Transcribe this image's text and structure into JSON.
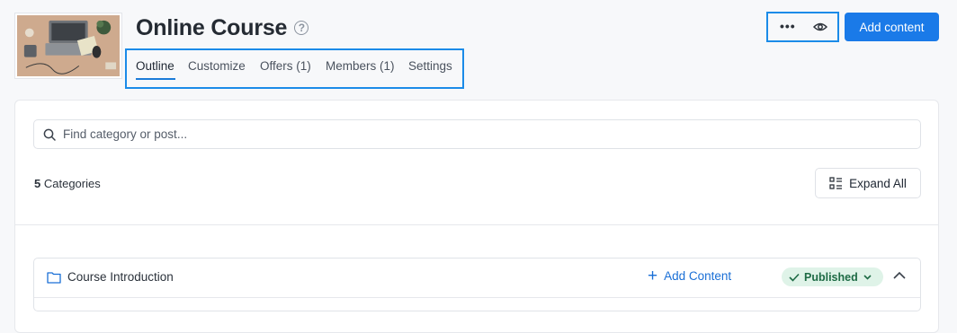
{
  "course": {
    "title": "Online Course",
    "help_icon": "?"
  },
  "tabs": [
    {
      "label": "Outline",
      "active": true
    },
    {
      "label": "Customize",
      "active": false
    },
    {
      "label": "Offers (1)",
      "active": false
    },
    {
      "label": "Members (1)",
      "active": false
    },
    {
      "label": "Settings",
      "active": false
    }
  ],
  "actions": {
    "more_icon": "•••",
    "preview_icon": "eye-icon",
    "add_content_label": "Add content"
  },
  "search": {
    "placeholder": "Find category or post..."
  },
  "summary": {
    "count": "5",
    "label": "Categories"
  },
  "expand_all_label": "Expand All",
  "categories": [
    {
      "name": "Course Introduction",
      "add_label": "Add Content",
      "status": "Published"
    }
  ],
  "colors": {
    "accent": "#1a7ae8",
    "highlight_border": "#1b8be8",
    "published_bg": "#dff3e8",
    "published_text": "#1e6b45"
  }
}
